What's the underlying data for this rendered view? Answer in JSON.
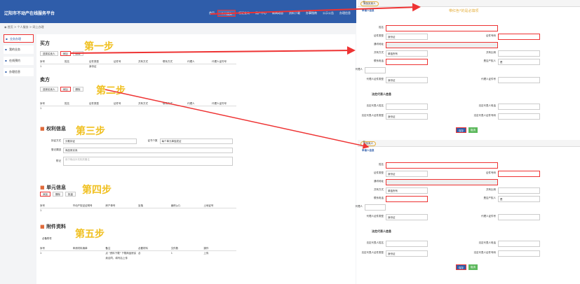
{
  "app": {
    "logo": "辽阳市不动产在线服务平台",
    "nav": [
      "首页",
      "个人服务",
      "领证查询",
      "用户中心",
      "新闻动态",
      "资料下载",
      "办事指南",
      "公示公告",
      "办理信息"
    ]
  },
  "crumb": "◉ 首页 > 个人服务 > 网上办理",
  "side": [
    "业务办理",
    "我的业务",
    "在线预约",
    "办理信息"
  ],
  "buyer": {
    "title": "买方",
    "step": "第一步",
    "buttons": [
      "选择买卖人",
      "添加",
      "删除"
    ],
    "headers": [
      "序号",
      "姓名",
      "证件类型",
      "证件号",
      "共有方式",
      "联系方式",
      "代理人",
      "代理人证件号"
    ],
    "row": [
      "1",
      "",
      "身份证",
      "",
      "",
      "",
      "",
      ""
    ]
  },
  "seller": {
    "title": "卖方",
    "step": "第二步",
    "buttons": [
      "选择买卖人",
      "添加",
      "删除"
    ],
    "headers": [
      "序号",
      "姓名",
      "证件类型",
      "证件号",
      "共有方式",
      "联系方式",
      "代理人",
      "代理人证件号"
    ],
    "row": [
      "1",
      "",
      "",
      "",
      "",
      "",
      "",
      ""
    ]
  },
  "rights": {
    "title": "权利信息",
    "step": "第三步",
    "method_label": "持证方式",
    "method_value": "分散持证",
    "count_label": "证书个数",
    "count_value": "每个单元单独发证",
    "reason_label": "登记原因",
    "reason_value": "商品房买卖",
    "remark_label": "附记",
    "remark_placeholder": "用于输出补充相关备注"
  },
  "unit": {
    "title": "单元信息",
    "step": "第四步",
    "buttons": [
      "添加",
      "删除",
      "批量"
    ],
    "headers": [
      "序号",
      "不动产权证证明号",
      "房产单号",
      "坐落",
      "面积(㎡)",
      "土地证号"
    ],
    "row": [
      "1",
      "",
      "",
      "",
      "",
      ""
    ]
  },
  "attach": {
    "title": "附件资料",
    "step": "第五步",
    "sub": "必备附件",
    "headers": [
      "序号",
      "申请材料清单",
      "备注",
      "必要材料",
      "文件数",
      "操作"
    ],
    "row": [
      "1",
      "",
      "点 \"资料下载\" 下载商品房买卖合同，填写后上传",
      "必",
      "1",
      "上传"
    ]
  },
  "dialog1": {
    "tag": "添加买卖人",
    "note": "带红色*的是必填项",
    "sub": "申请人信息"
  },
  "dialog2": {
    "tag": "添加卖人",
    "sub": "申请人信息"
  },
  "form": {
    "name": "姓名",
    "id_type": "证件类型",
    "id_type_value": "身份证",
    "id_no": "证件号码",
    "addr": "通讯地址",
    "share": "共有方式",
    "share_value": "单独所有",
    "ratio": "共有比例",
    "phone": "联系电话",
    "property": "是否产权人",
    "property_value": "是",
    "agent": "代理人",
    "agent_type": "代理人证件类型",
    "agent_type_value": "身份证",
    "agent_no": "代理人证件号",
    "legal": "法定代表人信息",
    "legal_name": "法定代表人姓名",
    "legal_phone": "法定代表人电话",
    "legal_type": "法定代表人证件类型",
    "legal_type_value": "身份证",
    "legal_no": "法定代表人证件号码",
    "save": "保存",
    "cancel": "取消"
  },
  "colors": {
    "accent": "#2f5daa",
    "highlight": "#e33",
    "step": "#f0c020"
  }
}
